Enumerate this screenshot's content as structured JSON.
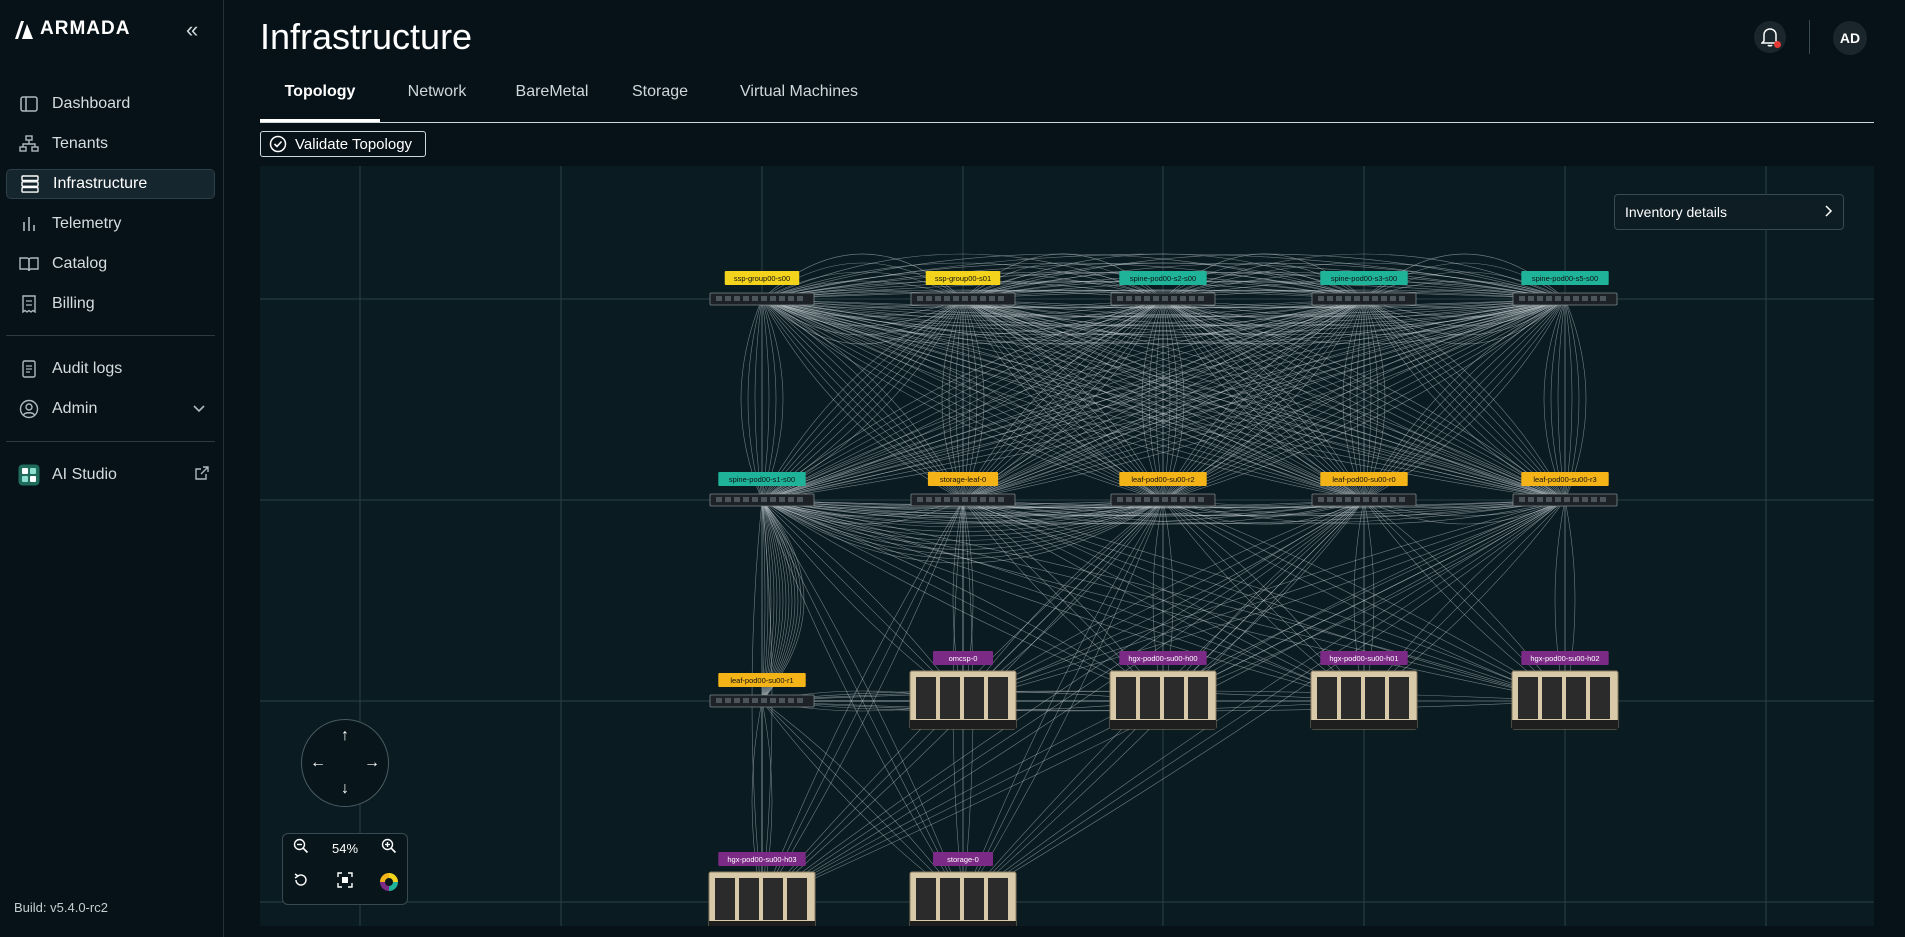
{
  "app": {
    "brand": "ARMADA",
    "build": "Build: v5.4.0-rc2"
  },
  "sidebar": {
    "items": [
      {
        "label": "Dashboard",
        "icon": "dashboard-icon"
      },
      {
        "label": "Tenants",
        "icon": "tenants-icon"
      },
      {
        "label": "Infrastructure",
        "icon": "server-icon",
        "active": true
      },
      {
        "label": "Telemetry",
        "icon": "chart-icon"
      },
      {
        "label": "Catalog",
        "icon": "book-icon"
      },
      {
        "label": "Billing",
        "icon": "receipt-icon"
      }
    ],
    "items2": [
      {
        "label": "Audit logs",
        "icon": "document-icon"
      },
      {
        "label": "Admin",
        "icon": "admin-icon"
      }
    ],
    "studio": {
      "label": "AI Studio",
      "icon": "studio-icon"
    }
  },
  "header": {
    "title": "Infrastructure",
    "avatar_initials": "AD"
  },
  "tabs": [
    "Topology",
    "Network",
    "BareMetal",
    "Storage",
    "Virtual Machines"
  ],
  "toolbar": {
    "validate_label": "Validate Topology"
  },
  "canvas": {
    "inventory_label": "Inventory details",
    "zoom_level": "54%",
    "nodes": [
      {
        "label": "ssp-group00-s00",
        "type": "switch",
        "color": "yellow"
      },
      {
        "label": "ssp-group00-s01",
        "type": "switch",
        "color": "yellow"
      },
      {
        "label": "spine-pod00-s2-s00",
        "type": "switch",
        "color": "teal"
      },
      {
        "label": "spine-pod00-s3-s00",
        "type": "switch",
        "color": "teal"
      },
      {
        "label": "spine-pod00-s5-s00",
        "type": "switch",
        "color": "teal"
      },
      {
        "label": "spine-pod00-s1-s00",
        "type": "switch",
        "color": "teal"
      },
      {
        "label": "storage-leaf-0",
        "type": "switch",
        "color": "orange"
      },
      {
        "label": "leaf-pod00-su00-r2",
        "type": "switch",
        "color": "orange"
      },
      {
        "label": "leaf-pod00-su00-r0",
        "type": "switch",
        "color": "orange"
      },
      {
        "label": "leaf-pod00-su00-r3",
        "type": "switch",
        "color": "orange"
      },
      {
        "label": "leaf-pod00-su00-r1",
        "type": "switch",
        "color": "orange"
      },
      {
        "label": "omcsp-0",
        "type": "server",
        "color": "purple"
      },
      {
        "label": "hgx-pod00-su00-h00",
        "type": "server",
        "color": "purple"
      },
      {
        "label": "hgx-pod00-su00-h01",
        "type": "server",
        "color": "purple"
      },
      {
        "label": "hgx-pod00-su00-h02",
        "type": "server",
        "color": "purple"
      },
      {
        "label": "hgx-pod00-su00-h03",
        "type": "server",
        "color": "purple"
      },
      {
        "label": "storage-0",
        "type": "server",
        "color": "purple"
      }
    ]
  },
  "colors": {
    "yellow": "#f4d31c",
    "teal": "#1fb39a",
    "orange": "#f4b418",
    "purple": "#7b2a86",
    "background": "#061217",
    "canvas": "#0a1b21"
  }
}
